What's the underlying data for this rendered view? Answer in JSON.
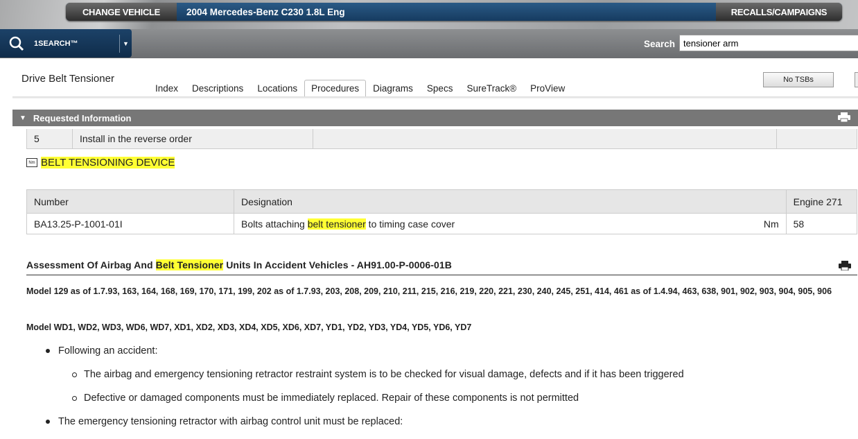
{
  "header": {
    "change_vehicle": "CHANGE VEHICLE",
    "vehicle": "2004 Mercedes-Benz C230 1.8L Eng",
    "recalls": "RECALLS/CAMPAIGNS"
  },
  "onesearch": {
    "label": "1SEARCH™"
  },
  "search": {
    "label": "Search",
    "value": "tensioner arm"
  },
  "page": {
    "title": "Drive Belt Tensioner",
    "no_tsbs": "No TSBs"
  },
  "tabs": [
    {
      "label": "Index"
    },
    {
      "label": "Descriptions"
    },
    {
      "label": "Locations"
    },
    {
      "label": "Procedures",
      "active": true
    },
    {
      "label": "Diagrams"
    },
    {
      "label": "Specs"
    },
    {
      "label": "SureTrack®"
    },
    {
      "label": "ProView"
    }
  ],
  "section": {
    "title": "Requested Information"
  },
  "step": {
    "number": "5",
    "text": "Install in the reverse order"
  },
  "torque": {
    "icon_text": "Nm",
    "heading": "BELT TENSIONING DEVICE",
    "headers": [
      "Number",
      "Designation",
      "Engine 271"
    ],
    "row": {
      "number": "BA13.25-P-1001-01I",
      "designation_pre": "Bolts attaching ",
      "designation_hl": "belt tensioner",
      "designation_post": " to timing case cover",
      "unit": "Nm",
      "value": "58"
    }
  },
  "article": {
    "title_pre": "Assessment Of Airbag And ",
    "title_hl": "Belt Tensioner",
    "title_post": " Units In Accident Vehicles - AH91.00-P-0006-01B",
    "models1": "Model 129 as of 1.7.93, 163, 164, 168, 169, 170, 171, 199, 202 as of 1.7.93, 203, 208, 209, 210, 211, 215, 216, 219, 220, 221, 230, 240, 245, 251, 414, 461 as of 1.4.94, 463, 638, 901, 902, 903, 904, 905, 906",
    "models2": "Model WD1, WD2, WD3, WD6, WD7, XD1, XD2, XD3, XD4, XD5, XD6, XD7, YD1, YD2, YD3, YD4, YD5, YD6, YD7",
    "bullets": [
      "Following an accident:",
      "The airbag and emergency tensioning retractor restraint system is to be checked for visual damage, defects and if it has been triggered",
      "Defective or damaged components must be immediately replaced. Repair of these components is not permitted",
      "The emergency tensioning retractor with airbag control unit must be replaced:"
    ]
  }
}
